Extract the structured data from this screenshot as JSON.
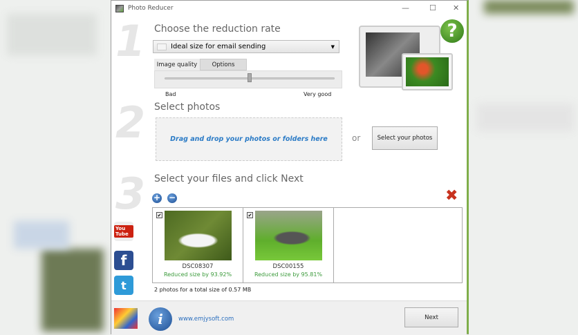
{
  "window": {
    "title": "Photo Reducer",
    "minimize": "—",
    "maximize": "☐",
    "close": "✕"
  },
  "step1": {
    "number": "1",
    "heading": "Choose the reduction rate",
    "preset": "Ideal size for email sending",
    "tabs": [
      "Image quality",
      "Options"
    ],
    "quality_value_percent": 50,
    "min_label": "Bad",
    "max_label": "Very good"
  },
  "help": {
    "icon": "?"
  },
  "step2": {
    "number": "2",
    "heading": "Select photos",
    "drop_text": "Drag and drop your photos or folders here",
    "or": "or",
    "select_button": "Select your photos"
  },
  "step3": {
    "number": "3",
    "heading": "Select your files and click Next",
    "add": "+",
    "remove": "−",
    "clear": "✖",
    "files": [
      {
        "name": "DSC08307",
        "status": "Reduced size by 93.92%",
        "checked": true
      },
      {
        "name": "DSC00155",
        "status": "Reduced size by 95.81%",
        "checked": true
      }
    ],
    "summary": "2 photos for a total size of 0.57 MB"
  },
  "social": {
    "youtube": "You Tube",
    "facebook": "f",
    "twitter": "t"
  },
  "footer": {
    "info": "i",
    "link": "www.emjysoft.com",
    "next": "Next"
  }
}
